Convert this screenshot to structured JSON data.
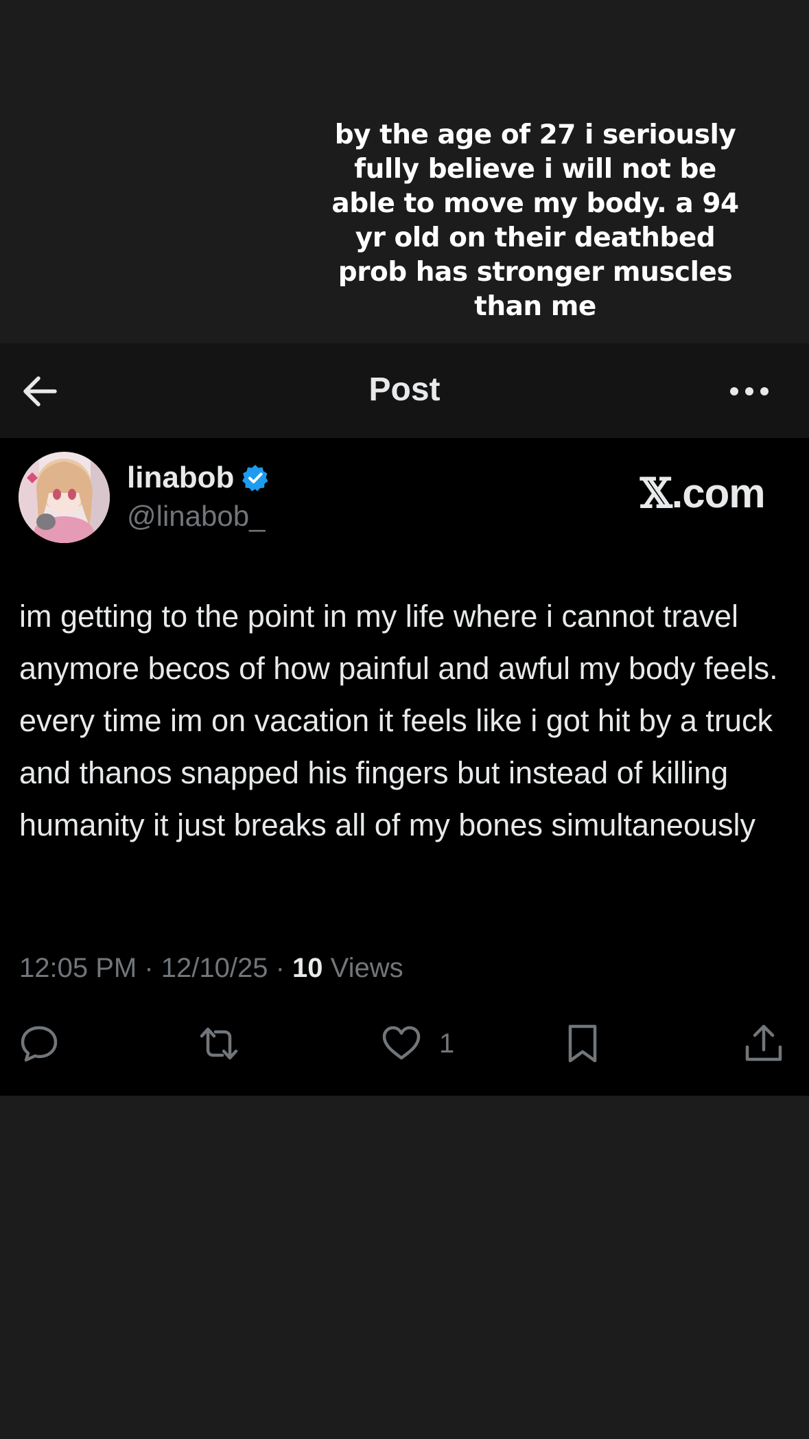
{
  "caption": {
    "text": "by the age of 27 i seriously fully believe i will not be able to move my body. a 94 yr old on their deathbed prob has stronger muscles than me"
  },
  "header": {
    "title": "Post",
    "back_icon": "arrow-left-icon",
    "more_icon": "more-horizontal-icon"
  },
  "post": {
    "author": {
      "display_name": "linabob",
      "handle": "@linabob_",
      "verified": true,
      "verified_color": "#1d9bf0"
    },
    "brand": {
      "x_glyph": "𝕏",
      "suffix": ".com"
    },
    "text": "im getting to the point in my life where i cannot travel anymore becos of how painful and awful my body feels. every time im on vacation it feels like i got hit by a truck and thanos snapped his fingers but instead of killing humanity it just breaks all of my bones simultaneously",
    "meta": {
      "time": "12:05 PM",
      "separator": " · ",
      "date": "12/10/25",
      "views_count": "10",
      "views_label": "Views"
    },
    "actions": {
      "reply_icon": "reply-icon",
      "repost_icon": "repost-icon",
      "like_icon": "heart-icon",
      "like_count": "1",
      "bookmark_icon": "bookmark-icon",
      "share_icon": "share-icon"
    }
  },
  "colors": {
    "page_bg": "#1c1c1c",
    "header_bg": "#141414",
    "card_bg": "#000000",
    "primary_text": "#e7e9ea",
    "secondary_text": "#71767b"
  }
}
